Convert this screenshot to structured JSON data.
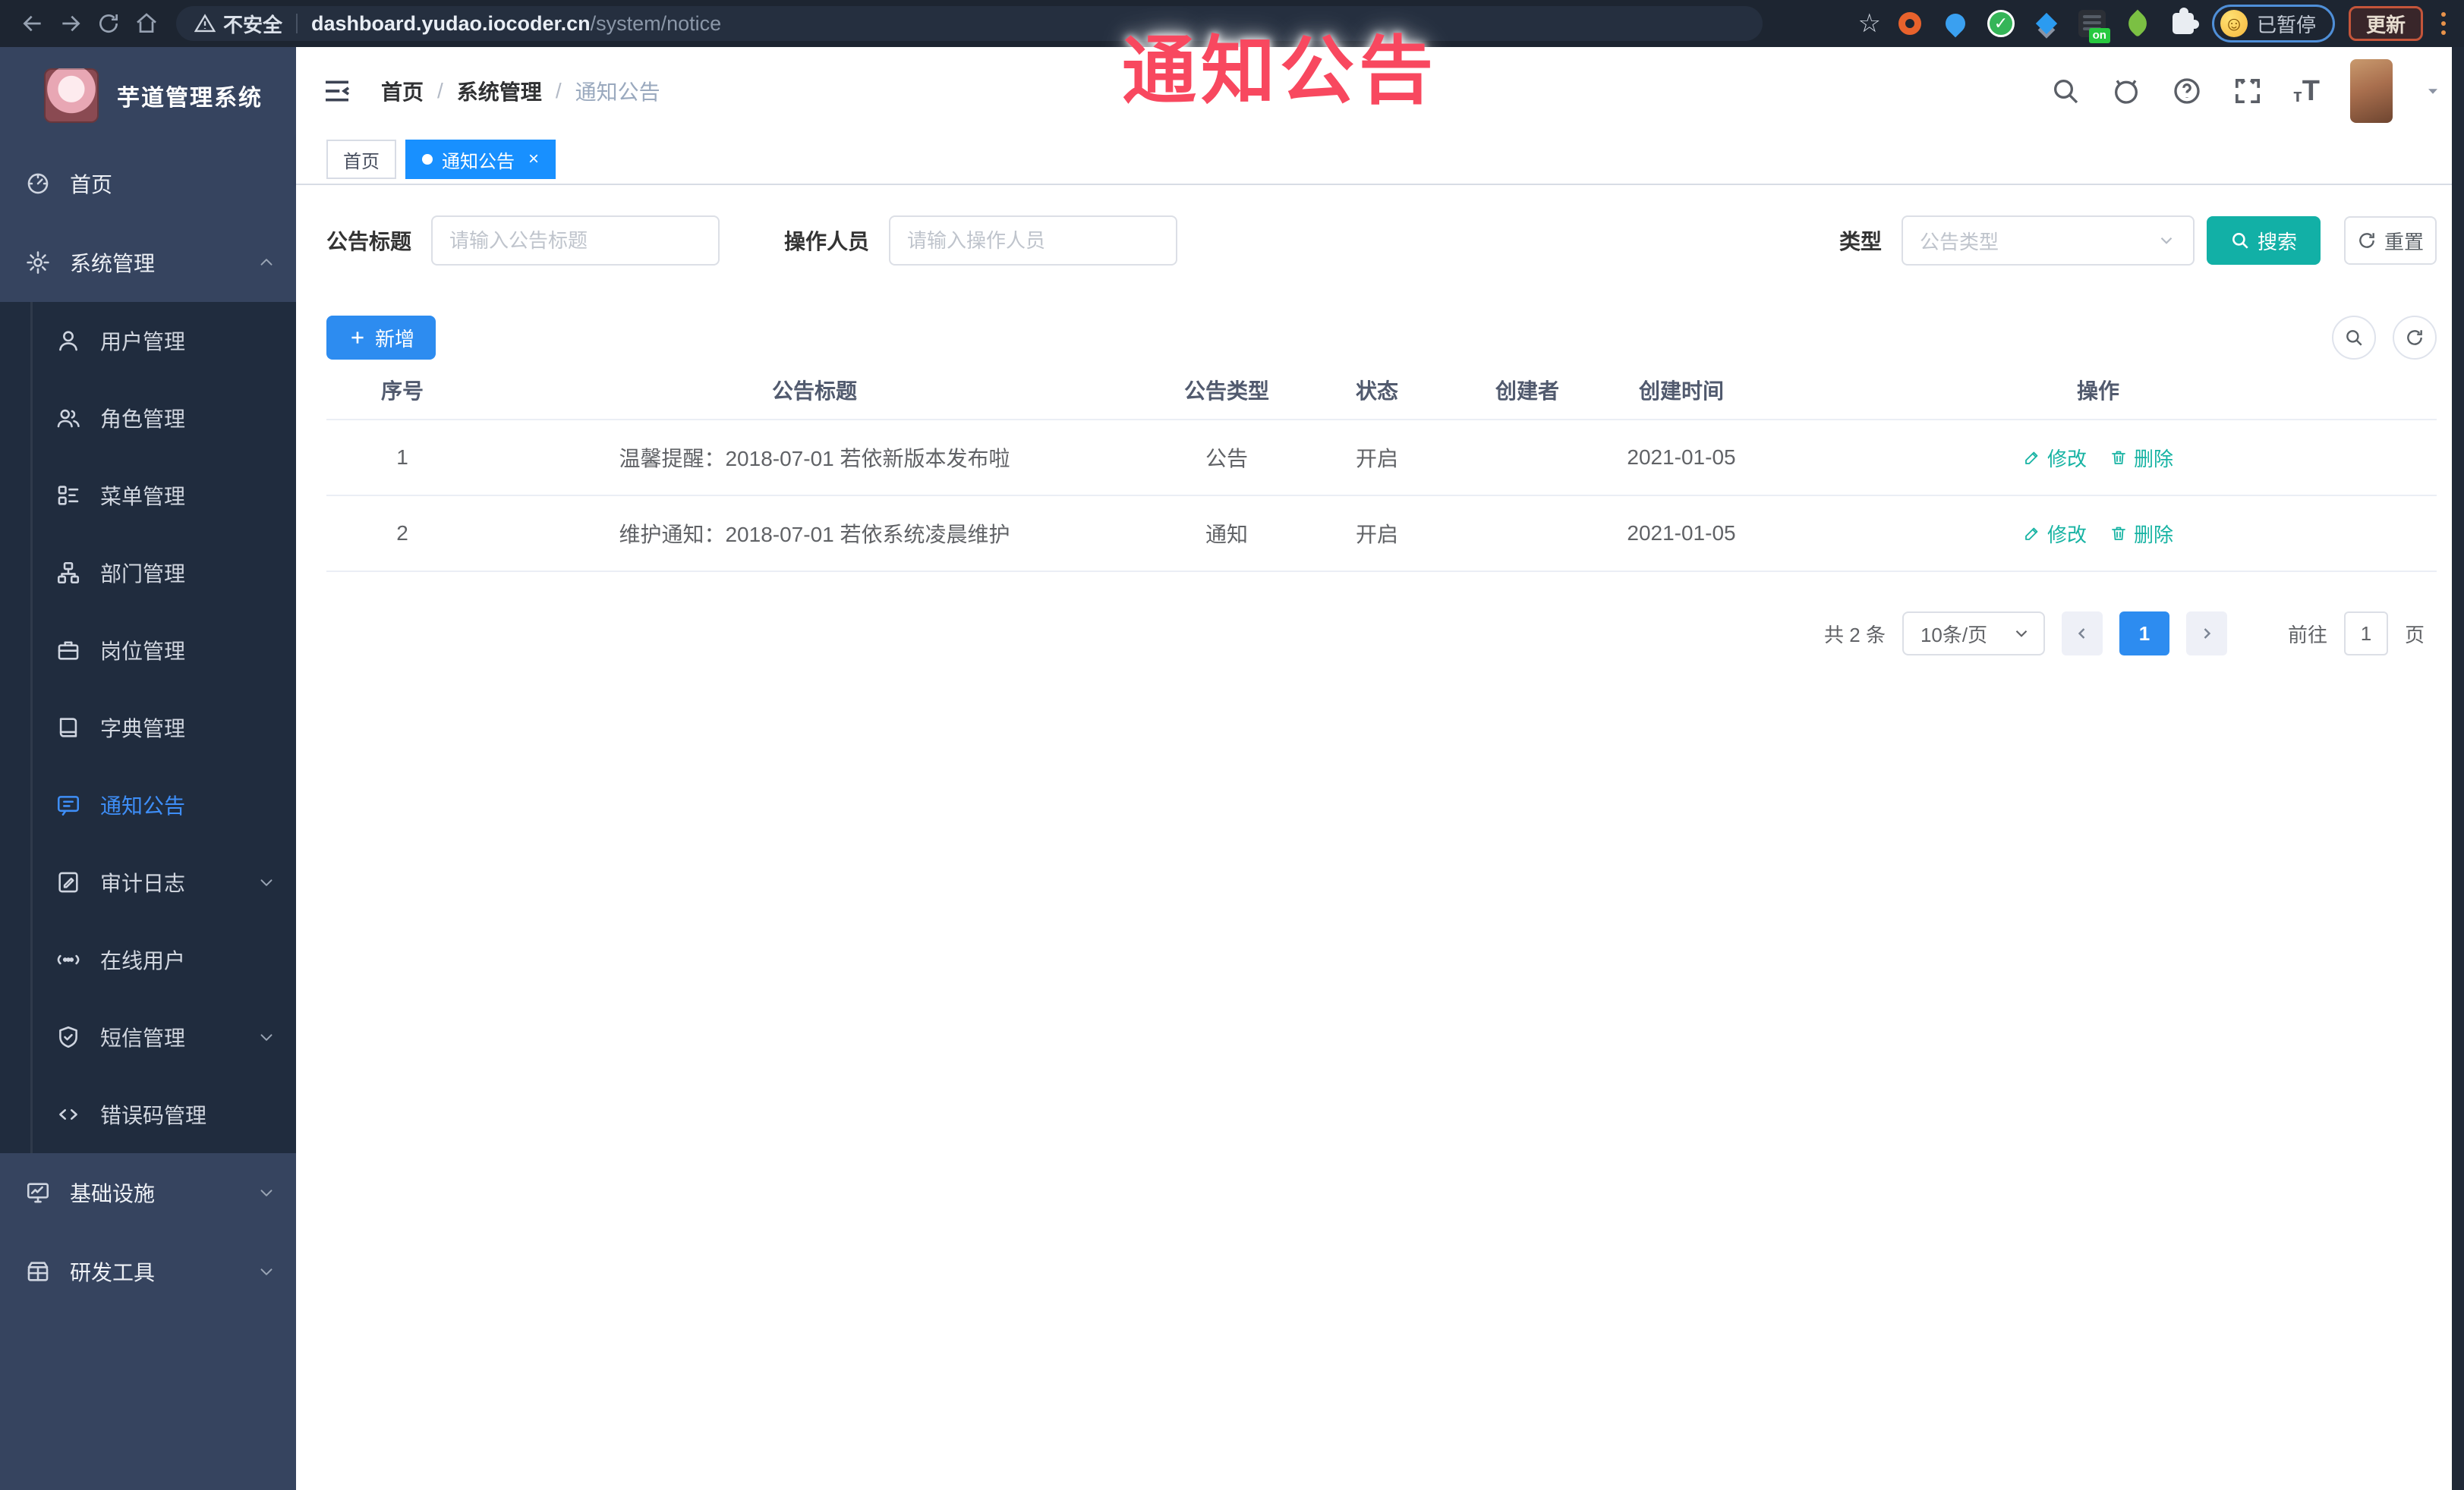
{
  "browser": {
    "not_secure": "不安全",
    "url_host": "dashboard.yudao.iocoder.cn",
    "url_path": "/system/notice",
    "paused_label": "已暂停",
    "update_label": "更新",
    "ext_badge_on": "on",
    "extensions": [
      "orange-ring-extension-icon",
      "blue-pin-extension-icon",
      "green-check-extension-icon",
      "blue-diamond-extension-icon",
      "database-on-extension-icon",
      "green-leaf-extension-icon",
      "puzzle-extensions-icon"
    ]
  },
  "overlay": {
    "text": "通知公告",
    "color": "#f8485f"
  },
  "sidebar": {
    "title": "芋道管理系统",
    "menu": [
      {
        "label": "首页",
        "icon": "dashboard-icon",
        "level": "top"
      },
      {
        "label": "系统管理",
        "icon": "gear-icon",
        "level": "top",
        "chevron": "up"
      },
      {
        "label": "用户管理",
        "icon": "user-icon",
        "level": "sub"
      },
      {
        "label": "角色管理",
        "icon": "users-icon",
        "level": "sub"
      },
      {
        "label": "菜单管理",
        "icon": "menu-list-icon",
        "level": "sub"
      },
      {
        "label": "部门管理",
        "icon": "org-tree-icon",
        "level": "sub"
      },
      {
        "label": "岗位管理",
        "icon": "briefcase-icon",
        "level": "sub"
      },
      {
        "label": "字典管理",
        "icon": "book-icon",
        "level": "sub"
      },
      {
        "label": "通知公告",
        "icon": "notice-icon",
        "level": "sub",
        "active": true
      },
      {
        "label": "审计日志",
        "icon": "audit-log-icon",
        "level": "sub",
        "chevron": "down"
      },
      {
        "label": "在线用户",
        "icon": "online-users-icon",
        "level": "sub"
      },
      {
        "label": "短信管理",
        "icon": "shield-icon",
        "level": "sub",
        "chevron": "down"
      },
      {
        "label": "错误码管理",
        "icon": "code-icon",
        "level": "sub"
      },
      {
        "label": "基础设施",
        "icon": "monitor-icon",
        "level": "top",
        "chevron": "down"
      },
      {
        "label": "研发工具",
        "icon": "toolbox-icon",
        "level": "top",
        "chevron": "down"
      }
    ]
  },
  "header": {
    "breadcrumb": [
      "首页",
      "系统管理",
      "通知公告"
    ]
  },
  "tabs": [
    {
      "label": "首页",
      "active": false
    },
    {
      "label": "通知公告",
      "active": true,
      "close": "×"
    }
  ],
  "filters": {
    "title_label": "公告标题",
    "title_placeholder": "请输入公告标题",
    "operator_label": "操作人员",
    "operator_placeholder": "请输入操作人员",
    "type_label": "类型",
    "type_placeholder": "公告类型",
    "search_label": "搜索",
    "reset_label": "重置"
  },
  "toolbar": {
    "add_label": "新增"
  },
  "table": {
    "columns": [
      "序号",
      "公告标题",
      "公告类型",
      "状态",
      "创建者",
      "创建时间",
      "操作"
    ],
    "rows": [
      {
        "no": "1",
        "title": "温馨提醒：2018-07-01 若依新版本发布啦",
        "type": "公告",
        "status": "开启",
        "creator": "",
        "created": "2021-01-05"
      },
      {
        "no": "2",
        "title": "维护通知：2018-07-01 若依系统凌晨维护",
        "type": "通知",
        "status": "开启",
        "creator": "",
        "created": "2021-01-05"
      }
    ],
    "edit_label": "修改",
    "delete_label": "删除"
  },
  "pagination": {
    "total": "共 2 条",
    "page_size": "10条/页",
    "page": "1",
    "goto_label": "前往",
    "goto_value": "1",
    "page_unit": "页"
  },
  "colors": {
    "primary_blue": "#2d8cf0",
    "active_tab_blue": "#1890ff",
    "search_teal": "#12b0a6",
    "action_link_teal": "#17b3a3",
    "sidebar_bg": "#36445f",
    "submenu_bg": "#202c3e",
    "overlay_red": "#f8485f"
  }
}
